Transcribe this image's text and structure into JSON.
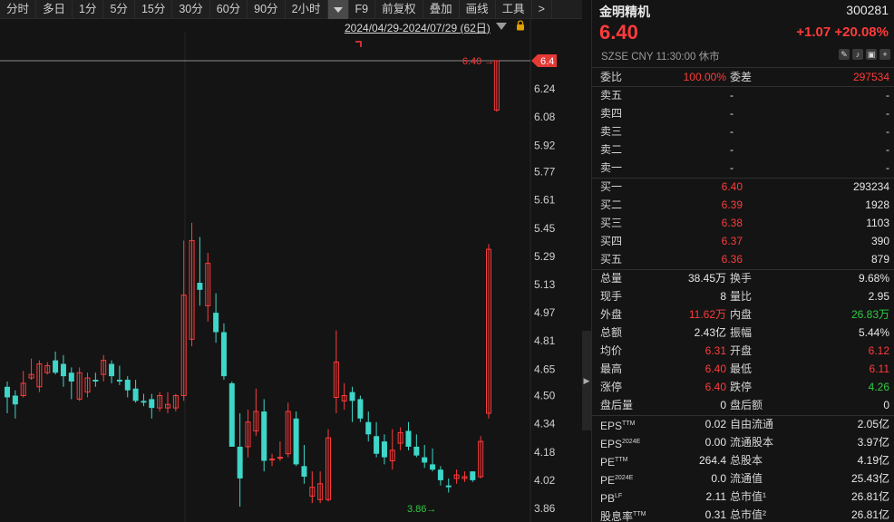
{
  "toolbar": {
    "items": [
      "分时",
      "多日",
      "1分",
      "5分",
      "15分",
      "30分",
      "60分",
      "90分",
      "2小时",
      "",
      "F9",
      "前复权",
      "叠加",
      "画线",
      "工具",
      ">"
    ]
  },
  "chart_header": {
    "range": "2024/04/29-2024/07/29 (62日)"
  },
  "chart_data": {
    "type": "candlestick",
    "price_axis_ticks": [
      "6.4",
      "6.24",
      "6.08",
      "5.92",
      "5.77",
      "5.61",
      "5.45",
      "5.29",
      "5.13",
      "4.97",
      "4.81",
      "4.65",
      "4.50",
      "4.34",
      "4.18",
      "4.02",
      "3.86"
    ],
    "current_price_marker": "6.4",
    "high_label": "6.40",
    "low_label": "3.86",
    "candles": [
      {
        "o": 4.55,
        "h": 4.58,
        "l": 4.4,
        "c": 4.49
      },
      {
        "o": 4.5,
        "h": 4.53,
        "l": 4.37,
        "c": 4.45
      },
      {
        "o": 4.5,
        "h": 4.64,
        "l": 4.49,
        "c": 4.57
      },
      {
        "o": 4.6,
        "h": 4.71,
        "l": 4.59,
        "c": 4.62
      },
      {
        "o": 4.55,
        "h": 4.7,
        "l": 4.52,
        "c": 4.68
      },
      {
        "o": 4.63,
        "h": 4.69,
        "l": 4.62,
        "c": 4.67
      },
      {
        "o": 4.7,
        "h": 4.75,
        "l": 4.62,
        "c": 4.63
      },
      {
        "o": 4.68,
        "h": 4.73,
        "l": 4.55,
        "c": 4.61
      },
      {
        "o": 4.63,
        "h": 4.66,
        "l": 4.48,
        "c": 4.58
      },
      {
        "o": 4.48,
        "h": 4.66,
        "l": 4.47,
        "c": 4.63
      },
      {
        "o": 4.52,
        "h": 4.63,
        "l": 4.49,
        "c": 4.6
      },
      {
        "o": 4.59,
        "h": 4.63,
        "l": 4.55,
        "c": 4.58
      },
      {
        "o": 4.62,
        "h": 4.73,
        "l": 4.58,
        "c": 4.7
      },
      {
        "o": 4.68,
        "h": 4.7,
        "l": 4.57,
        "c": 4.61
      },
      {
        "o": 4.59,
        "h": 4.67,
        "l": 4.56,
        "c": 4.58
      },
      {
        "o": 4.59,
        "h": 4.61,
        "l": 4.49,
        "c": 4.53
      },
      {
        "o": 4.54,
        "h": 4.59,
        "l": 4.46,
        "c": 4.47
      },
      {
        "o": 4.47,
        "h": 4.51,
        "l": 4.44,
        "c": 4.46
      },
      {
        "o": 4.48,
        "h": 4.51,
        "l": 4.37,
        "c": 4.43
      },
      {
        "o": 4.43,
        "h": 4.52,
        "l": 4.41,
        "c": 4.5
      },
      {
        "o": 4.43,
        "h": 4.52,
        "l": 4.4,
        "c": 4.45
      },
      {
        "o": 4.43,
        "h": 4.51,
        "l": 4.41,
        "c": 4.5
      },
      {
        "o": 4.5,
        "h": 5.38,
        "l": 4.47,
        "c": 5.07
      },
      {
        "o": 4.82,
        "h": 5.48,
        "l": 4.78,
        "c": 5.38
      },
      {
        "o": 5.14,
        "h": 5.4,
        "l": 5.01,
        "c": 5.1
      },
      {
        "o": 5.01,
        "h": 5.31,
        "l": 4.92,
        "c": 5.25
      },
      {
        "o": 4.97,
        "h": 5.08,
        "l": 4.8,
        "c": 4.86
      },
      {
        "o": 4.86,
        "h": 4.91,
        "l": 4.59,
        "c": 4.61
      },
      {
        "o": 4.57,
        "h": 4.58,
        "l": 4.21,
        "c": 4.21
      },
      {
        "o": 4.21,
        "h": 4.4,
        "l": 3.87,
        "c": 4.03
      },
      {
        "o": 4.21,
        "h": 4.42,
        "l": 4.15,
        "c": 4.35
      },
      {
        "o": 4.3,
        "h": 4.54,
        "l": 4.27,
        "c": 4.41
      },
      {
        "o": 4.41,
        "h": 4.48,
        "l": 4.07,
        "c": 4.13
      },
      {
        "o": 4.14,
        "h": 4.17,
        "l": 4.1,
        "c": 4.14
      },
      {
        "o": 4.15,
        "h": 4.24,
        "l": 4.13,
        "c": 4.15
      },
      {
        "o": 4.17,
        "h": 4.46,
        "l": 4.15,
        "c": 4.41
      },
      {
        "o": 4.37,
        "h": 4.41,
        "l": 4.1,
        "c": 4.11
      },
      {
        "o": 4.1,
        "h": 4.22,
        "l": 4.0,
        "c": 4.04
      },
      {
        "o": 3.93,
        "h": 4.07,
        "l": 3.89,
        "c": 3.98
      },
      {
        "o": 3.91,
        "h": 4.07,
        "l": 3.89,
        "c": 4.0
      },
      {
        "o": 3.91,
        "h": 4.31,
        "l": 3.9,
        "c": 4.26
      },
      {
        "o": 4.49,
        "h": 4.87,
        "l": 4.4,
        "c": 4.69
      },
      {
        "o": 4.47,
        "h": 4.57,
        "l": 4.42,
        "c": 4.5
      },
      {
        "o": 4.52,
        "h": 4.55,
        "l": 4.35,
        "c": 4.47
      },
      {
        "o": 4.48,
        "h": 4.5,
        "l": 4.35,
        "c": 4.37
      },
      {
        "o": 4.35,
        "h": 4.41,
        "l": 4.24,
        "c": 4.28
      },
      {
        "o": 4.27,
        "h": 4.35,
        "l": 4.15,
        "c": 4.17
      },
      {
        "o": 4.24,
        "h": 4.28,
        "l": 4.11,
        "c": 4.15
      },
      {
        "o": 4.13,
        "h": 4.31,
        "l": 4.08,
        "c": 4.19
      },
      {
        "o": 4.23,
        "h": 4.32,
        "l": 4.19,
        "c": 4.29
      },
      {
        "o": 4.3,
        "h": 4.35,
        "l": 4.19,
        "c": 4.21
      },
      {
        "o": 4.21,
        "h": 4.28,
        "l": 4.15,
        "c": 4.16
      },
      {
        "o": 4.15,
        "h": 4.22,
        "l": 4.09,
        "c": 4.12
      },
      {
        "o": 4.11,
        "h": 4.2,
        "l": 4.07,
        "c": 4.08
      },
      {
        "o": 4.08,
        "h": 4.1,
        "l": 3.99,
        "c": 4.02
      },
      {
        "o": 3.99,
        "h": 4.03,
        "l": 3.95,
        "c": 3.98
      },
      {
        "o": 4.03,
        "h": 4.08,
        "l": 4.0,
        "c": 4.05
      },
      {
        "o": 4.03,
        "h": 4.07,
        "l": 4.01,
        "c": 4.04
      },
      {
        "o": 4.07,
        "h": 4.07,
        "l": 4.01,
        "c": 4.02
      },
      {
        "o": 4.04,
        "h": 4.27,
        "l": 4.03,
        "c": 4.24
      },
      {
        "o": 4.4,
        "h": 5.36,
        "l": 4.37,
        "c": 5.33
      },
      {
        "o": 6.12,
        "h": 6.4,
        "l": 6.11,
        "c": 6.4
      }
    ]
  },
  "stock": {
    "name": "金明精机",
    "code": "300281",
    "price": "6.40",
    "change": "+1.07  +20.08%",
    "market": "SZSE  CNY  11:30:00  休市"
  },
  "bid_ratio": {
    "label1": "委比",
    "val1": "100.00%",
    "label2": "委差",
    "val2": "297534"
  },
  "asks": [
    {
      "label": "卖五",
      "price": "-",
      "vol": "-"
    },
    {
      "label": "卖四",
      "price": "-",
      "vol": "-"
    },
    {
      "label": "卖三",
      "price": "-",
      "vol": "-"
    },
    {
      "label": "卖二",
      "price": "-",
      "vol": "-"
    },
    {
      "label": "卖一",
      "price": "-",
      "vol": "-"
    }
  ],
  "bids": [
    {
      "label": "买一",
      "price": "6.40",
      "vol": "293234"
    },
    {
      "label": "买二",
      "price": "6.39",
      "vol": "1928"
    },
    {
      "label": "买三",
      "price": "6.38",
      "vol": "1103"
    },
    {
      "label": "买四",
      "price": "6.37",
      "vol": "390"
    },
    {
      "label": "买五",
      "price": "6.36",
      "vol": "879"
    }
  ],
  "stats": [
    {
      "l1": "总量",
      "v1": "38.45万",
      "c1": "white",
      "l2": "换手",
      "v2": "9.68%",
      "c2": "white"
    },
    {
      "l1": "现手",
      "v1": "8",
      "c1": "white",
      "l2": "量比",
      "v2": "2.95",
      "c2": "white"
    },
    {
      "l1": "外盘",
      "v1": "11.62万",
      "c1": "red",
      "l2": "内盘",
      "v2": "26.83万",
      "c2": "green"
    },
    {
      "l1": "总额",
      "v1": "2.43亿",
      "c1": "white",
      "l2": "振幅",
      "v2": "5.44%",
      "c2": "white"
    },
    {
      "l1": "均价",
      "v1": "6.31",
      "c1": "red",
      "l2": "开盘",
      "v2": "6.12",
      "c2": "red"
    },
    {
      "l1": "最高",
      "v1": "6.40",
      "c1": "red",
      "l2": "最低",
      "v2": "6.11",
      "c2": "red"
    },
    {
      "l1": "涨停",
      "v1": "6.40",
      "c1": "red",
      "l2": "跌停",
      "v2": "4.26",
      "c2": "green"
    },
    {
      "l1": "盘后量",
      "v1": "0",
      "c1": "white",
      "l2": "盘后额",
      "v2": "0",
      "c2": "white"
    }
  ],
  "fundamentals": [
    {
      "l1": "EPS",
      "s1": "TTM",
      "v1": "0.02",
      "l2": "自由流通",
      "v2": "2.05亿"
    },
    {
      "l1": "EPS",
      "s1": "2024E",
      "v1": "0.00",
      "l2": "流通股本",
      "v2": "3.97亿"
    },
    {
      "l1": "PE",
      "s1": "TTM",
      "v1": "264.4",
      "l2": "总股本",
      "v2": "4.19亿"
    },
    {
      "l1": "PE",
      "s1": "2024E",
      "v1": "0.0",
      "l2": "流通值",
      "v2": "25.43亿"
    },
    {
      "l1": "PB",
      "s1": "LF",
      "v1": "2.11",
      "l2": "总市值¹",
      "v2": "26.81亿"
    },
    {
      "l1": "股息率",
      "s1": "TTM",
      "v1": "0.31",
      "l2": "总市值²",
      "v2": "26.81亿"
    }
  ],
  "colors": {
    "up": "#ff3b3b",
    "down": "#3ed6c8",
    "green": "#2ecc40",
    "bg": "#141414"
  }
}
